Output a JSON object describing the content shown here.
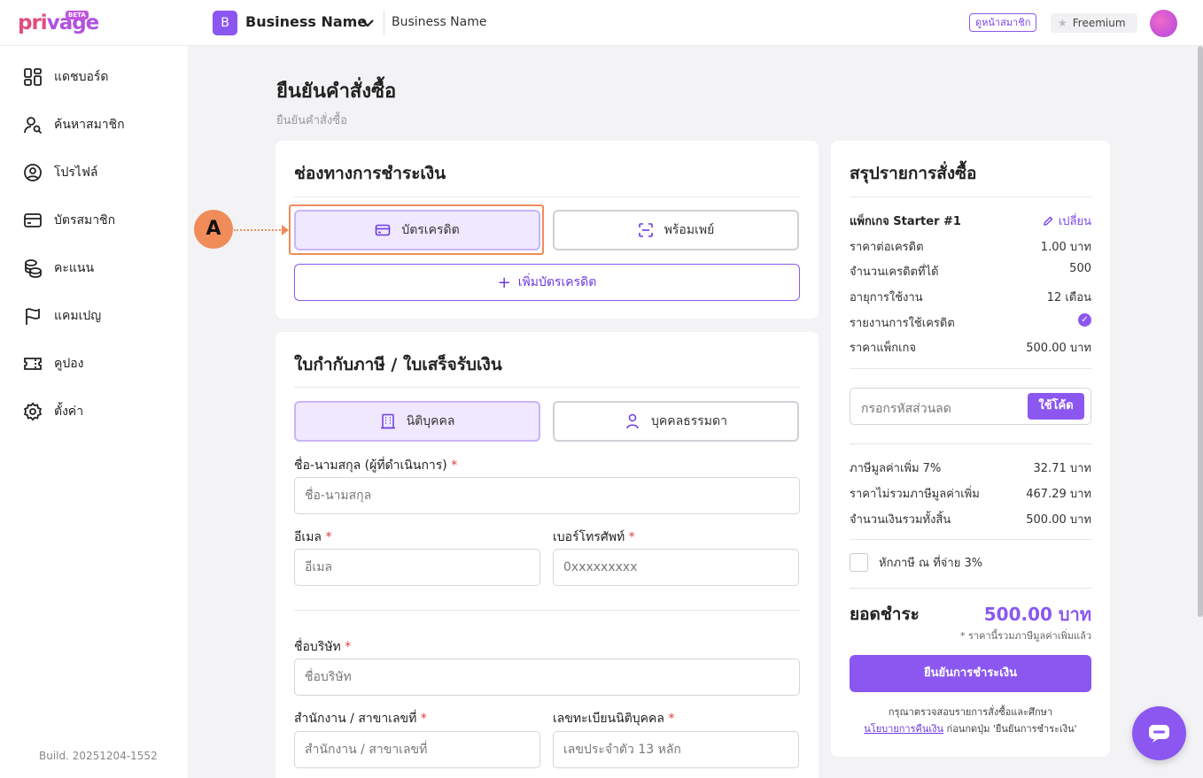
{
  "brand": {
    "logo_a": "pri",
    "logo_b": "vage",
    "beta": "BETA"
  },
  "header": {
    "business_initial": "B",
    "business_name": "Business Name",
    "business_name_secondary": "Business Name",
    "member_page_label": "ดูหน้าสมาชิก",
    "plan_label": "Freemium"
  },
  "sidebar": {
    "items": [
      {
        "label": "แดชบอร์ด",
        "icon": "dashboard-icon"
      },
      {
        "label": "ค้นหาสมาชิก",
        "icon": "user-search-icon"
      },
      {
        "label": "โปรไฟล์",
        "icon": "profile-icon"
      },
      {
        "label": "บัตรสมาชิก",
        "icon": "card-icon"
      },
      {
        "label": "คะแนน",
        "icon": "coins-icon"
      },
      {
        "label": "แคมเปญ",
        "icon": "flag-icon"
      },
      {
        "label": "คูปอง",
        "icon": "ticket-icon"
      },
      {
        "label": "ตั้งค่า",
        "icon": "gear-icon"
      }
    ],
    "build": "Build. 20251204-1552"
  },
  "page": {
    "title": "ยืนยันคำสั่งซื้อ",
    "breadcrumb": "ยืนยันคำสั่งซื้อ"
  },
  "payment": {
    "title": "ช่องทางการชำระเงิน",
    "credit_card": "บัตรเครดิต",
    "promptpay": "พร้อมเพย์",
    "add_card": "เพิ่มบัตรเครดิต",
    "annotation": "A"
  },
  "invoice": {
    "title": "ใบกำกับภาษี / ใบเสร็จรับเงิน",
    "juristic": "นิติบุคคล",
    "individual": "บุคคลธรรมดา",
    "name_label": "ชื่อ-นามสกุล (ผู้ที่ดำเนินการ)",
    "name_placeholder": "ชื่อ-นามสกุล",
    "email_label": "อีเมล",
    "email_placeholder": "อีเมล",
    "phone_label": "เบอร์โทรศัพท์",
    "phone_placeholder": "0xxxxxxxxx",
    "company_label": "ชื่อบริษัท",
    "company_placeholder": "ชื่อบริษัท",
    "branch_label": "สำนักงาน / สาขาเลขที่",
    "branch_placeholder": "สำนักงาน / สาขาเลขที่",
    "taxid_label": "เลขทะเบียนนิติบุคคล",
    "taxid_placeholder": "เลขประจำตัว 13 หลัก",
    "required_mark": "*"
  },
  "summary": {
    "title": "สรุปรายการสั่งซื้อ",
    "package_name": "แพ็กเกจ Starter #1",
    "change": "เปลี่ยน",
    "rows": [
      {
        "label": "ราคาต่อเครดิต",
        "value": "1.00 บาท"
      },
      {
        "label": "จำนวนเครดิตที่ได้",
        "value": "500"
      },
      {
        "label": "อายุการใช้งาน",
        "value": "12 เดือน"
      }
    ],
    "report_label": "รายงานการใช้เครดิต",
    "package_price_label": "ราคาแพ็กเกจ",
    "package_price_value": "500.00 บาท",
    "coupon_placeholder": "กรอกรหัสส่วนลด",
    "coupon_button": "ใช้โค้ด",
    "tax_rows": [
      {
        "label": "ภาษีมูลค่าเพิ่ม 7%",
        "value": "32.71 บาท"
      },
      {
        "label": "ราคาไม่รวมภาษีมูลค่าเพิ่ม",
        "value": "467.29 บาท"
      },
      {
        "label": "จำนวนเงินรวมทั้งสิ้น",
        "value": "500.00 บาท"
      }
    ],
    "withholding_label": "หักภาษี ณ ที่จ่าย 3%",
    "total_label": "ยอดชำระ",
    "total_value": "500.00 บาท",
    "vat_note": "* ราคานี้รวมภาษีมูลค่าเพิ่มแล้ว",
    "confirm_button": "ยืนยันการชำระเงิน",
    "note_line1": "กรุณาตรวจสอบรายการสั่งซื้อและศึกษา",
    "note_link": "นโยบายการคืนเงิน",
    "note_line2": " ก่อนกดปุ่ม 'ยืนยันการชำระเงิน'"
  },
  "colors": {
    "accent": "#8b57f0",
    "annotation": "#ef8c5a"
  }
}
